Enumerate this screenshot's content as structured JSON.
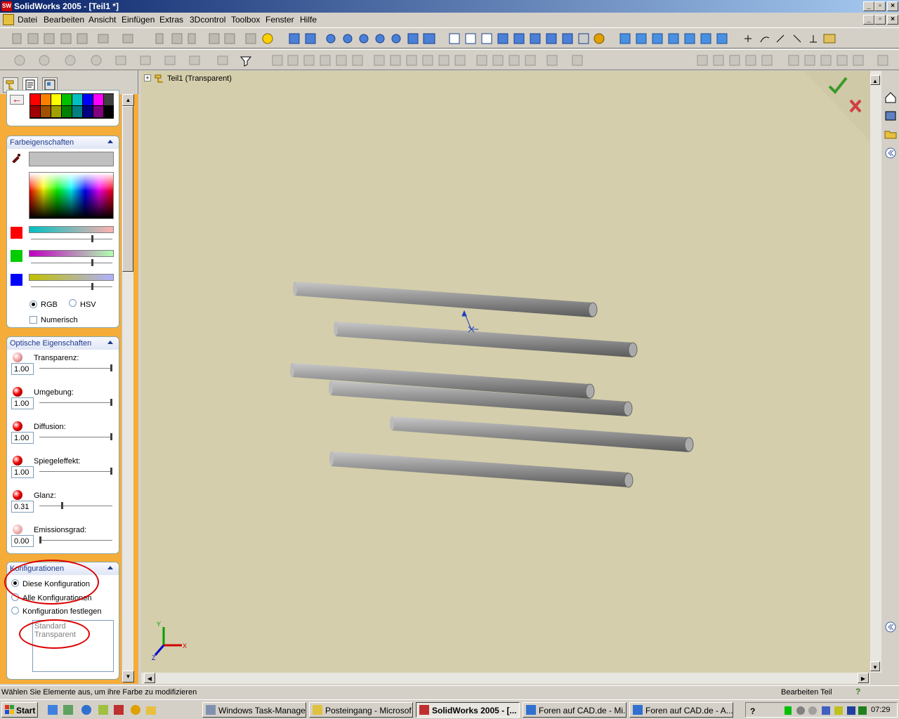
{
  "window": {
    "title": "SolidWorks 2005 - [Teil1 *]",
    "logo": "SW"
  },
  "menu": [
    "Datei",
    "Bearbeiten",
    "Ansicht",
    "Einfügen",
    "Extras",
    "3Dcontrol",
    "Toolbox",
    "Fenster",
    "Hilfe"
  ],
  "tree": {
    "root_label": "Teil1  (Transparent)",
    "expand": "+"
  },
  "color_props": {
    "header": "Farbeigenschaften",
    "channel_colors": [
      "#ff0000",
      "#00cc00",
      "#0000ff"
    ],
    "swatches": [
      "#ff0000",
      "#ff8000",
      "#ffff00",
      "#00c000",
      "#00c0c0",
      "#0000ff",
      "#ff00ff",
      "#404040",
      "#a00000",
      "#a05000",
      "#a0a000",
      "#008000",
      "#008080",
      "#000080",
      "#800080",
      "#000000"
    ],
    "rgb_label": "RGB",
    "hsv_label": "HSV",
    "numeric_label": "Numerisch",
    "mode": "RGB"
  },
  "optical": {
    "header": "Optische Eigenschaften",
    "items": [
      {
        "label": "Transparenz:",
        "value": "1.00",
        "level": 1.0
      },
      {
        "label": "Umgebung:",
        "value": "1.00",
        "level": 1.0
      },
      {
        "label": "Diffusion:",
        "value": "1.00",
        "level": 1.0
      },
      {
        "label": "Spiegeleffekt:",
        "value": "1.00",
        "level": 1.0
      },
      {
        "label": "Glanz:",
        "value": "0.31",
        "level": 0.31
      },
      {
        "label": "Emissionsgrad:",
        "value": "0.00",
        "level": 0.0
      }
    ]
  },
  "configs": {
    "header": "Konfigurationen",
    "options": [
      "Diese Konfiguration",
      "Alle Konfigurationen",
      "Konfiguration festlegen"
    ],
    "selected": 0,
    "list": [
      "Standard",
      "Transparent"
    ]
  },
  "axes": {
    "x": "X",
    "y": "Y",
    "z": "Z"
  },
  "status": {
    "message": "Wählen Sie Elemente aus, um ihre Farbe zu modifizieren",
    "mode": "Bearbeiten Teil",
    "help": "?"
  },
  "taskbar": {
    "start": "Start",
    "tasks": [
      "Windows Task-Manager",
      "Posteingang - Microsof...",
      "SolidWorks 2005 - [...",
      "Foren auf CAD.de - Mi...",
      "Foren auf CAD.de - A..."
    ],
    "active": 2,
    "clock": "07:29"
  },
  "accent": {
    "title_start": "#0a246a",
    "viewport": "#d4ceac",
    "panel_bg": "#f6ac38",
    "annotation": "#dd0000"
  }
}
